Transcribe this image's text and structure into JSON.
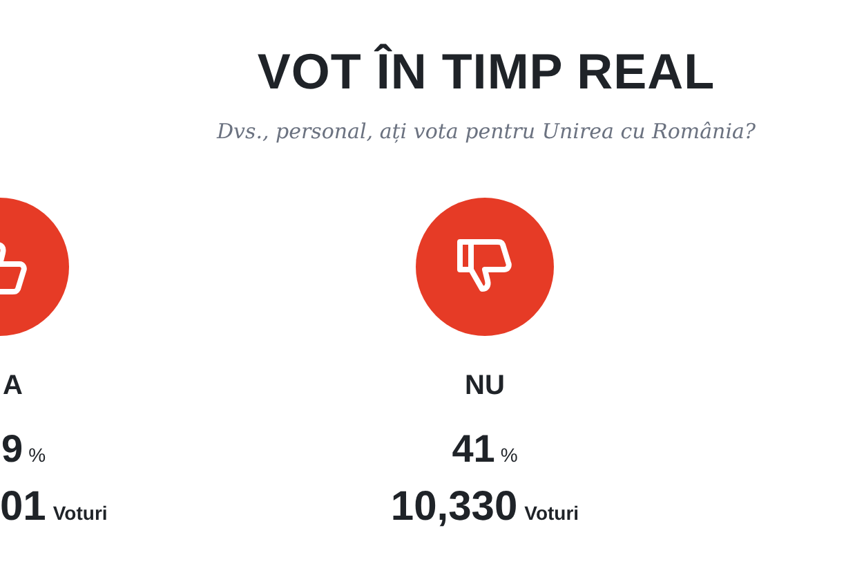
{
  "title": "VOT ÎN TIMP REAL",
  "question": "Dvs., personal, ați vota pentru Unirea cu România?",
  "options": [
    {
      "kind": "up",
      "label": "A",
      "percent": "9",
      "percent_sign": "%",
      "votes": "01",
      "votes_unit": "Voturi"
    },
    {
      "kind": "down",
      "label": "NU",
      "percent": "41",
      "percent_sign": "%",
      "votes": "10,330",
      "votes_unit": "Voturi"
    }
  ]
}
